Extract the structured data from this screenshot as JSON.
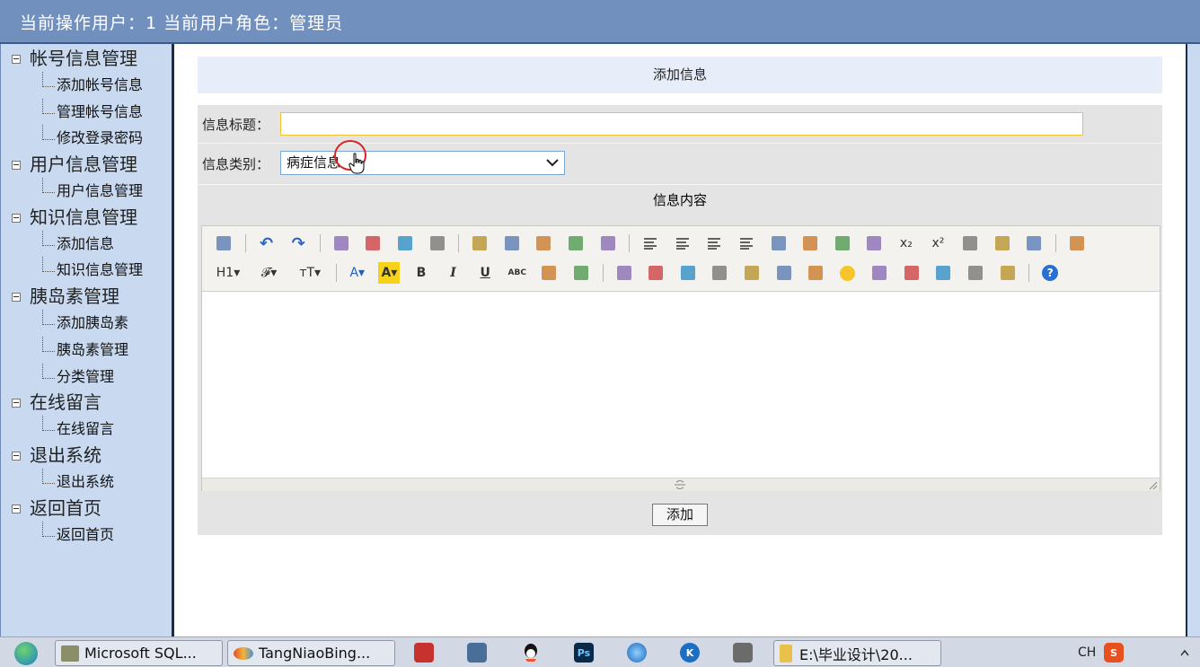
{
  "header": {
    "title": "当前操作用户：1 当前用户角色：管理员"
  },
  "sidebar": {
    "groups": [
      {
        "title": "帐号信息管理",
        "items": [
          "添加帐号信息",
          "管理帐号信息",
          "修改登录密码"
        ]
      },
      {
        "title": "用户信息管理",
        "items": [
          "用户信息管理"
        ]
      },
      {
        "title": "知识信息管理",
        "items": [
          "添加信息",
          "知识信息管理"
        ]
      },
      {
        "title": "胰岛素管理",
        "items": [
          "添加胰岛素",
          "胰岛素管理",
          "分类管理"
        ]
      },
      {
        "title": "在线留言",
        "items": [
          "在线留言"
        ]
      },
      {
        "title": "退出系统",
        "items": [
          "退出系统"
        ]
      },
      {
        "title": "返回首页",
        "items": [
          "返回首页"
        ]
      }
    ]
  },
  "main": {
    "panel_title": "添加信息",
    "title_label": "信息标题：",
    "title_value": "",
    "category_label": "信息类别：",
    "category_value": "病症信息",
    "content_label": "信息内容",
    "submit_label": "添加"
  },
  "editor": {
    "toolbar_row1": [
      "source-icon",
      "undo-icon",
      "redo-icon",
      "preview-icon",
      "print-icon",
      "template-icon",
      "code-icon",
      "cut-icon",
      "copy-icon",
      "paste-icon",
      "paste-text-icon",
      "paste-word-icon",
      "align-left-icon",
      "align-center-icon",
      "align-right-icon",
      "justify-icon",
      "ordered-list-icon",
      "unordered-list-icon",
      "indent-icon",
      "outdent-icon",
      "subscript-icon",
      "superscript-icon",
      "clear-format-icon",
      "select-all-icon",
      "cursor-icon",
      "fullscreen-icon"
    ],
    "toolbar_row2": [
      "heading-icon",
      "font-family-icon",
      "font-size-icon",
      "font-color-icon",
      "highlight-icon",
      "bold-icon",
      "italic-icon",
      "underline-icon",
      "strikethrough-icon",
      "line-height-icon",
      "remove-format-icon",
      "image-icon",
      "multi-image-icon",
      "flash-icon",
      "media-icon",
      "attachment-icon",
      "table-icon",
      "hr-icon",
      "emoticon-icon",
      "map-icon",
      "pagebreak-icon",
      "anchor-icon",
      "link-icon",
      "unlink-icon",
      "help-icon"
    ],
    "labels": {
      "h1": "H1",
      "font": "𝓕",
      "size": "тT",
      "color": "A",
      "highlight": "A",
      "bold": "B",
      "italic": "I",
      "underline": "U",
      "strike": "ABC",
      "sub": "x₂",
      "sup": "x²"
    }
  },
  "taskbar": {
    "tasks": [
      {
        "label": "Microsoft SQL..."
      },
      {
        "label": "TangNiaoBing..."
      },
      {
        "label": "E:\\毕业设计\\20..."
      }
    ],
    "tray_lang": "CH",
    "colors": {
      "accent": "#7290bd",
      "sidebar": "#c9daf0"
    }
  }
}
